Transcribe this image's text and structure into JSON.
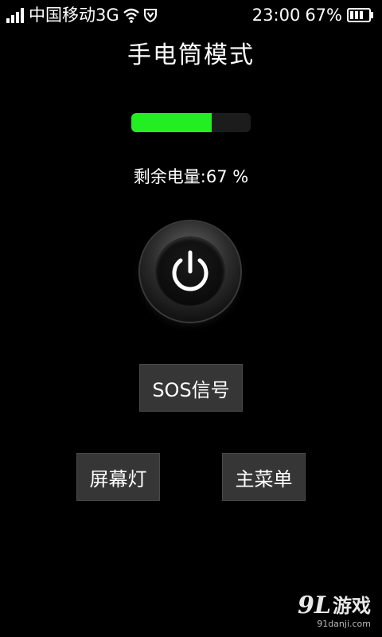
{
  "status_bar": {
    "carrier": "中国移动3G",
    "time": "23:00",
    "battery_percent": "67%",
    "icons": [
      "signal-icon",
      "wifi-icon",
      "shield-icon",
      "battery-icon"
    ]
  },
  "title": "手电筒模式",
  "battery": {
    "level": 0.67,
    "label": "剩余电量:67 %",
    "fill_color": "#22ee22"
  },
  "power_button": {
    "icon": "power-icon"
  },
  "buttons": {
    "sos": "SOS信号",
    "screen_light": "屏幕灯",
    "main_menu": "主菜单"
  },
  "watermark": {
    "logo_number": "9L",
    "logo_text": "游戏",
    "url": "91danji.com"
  }
}
